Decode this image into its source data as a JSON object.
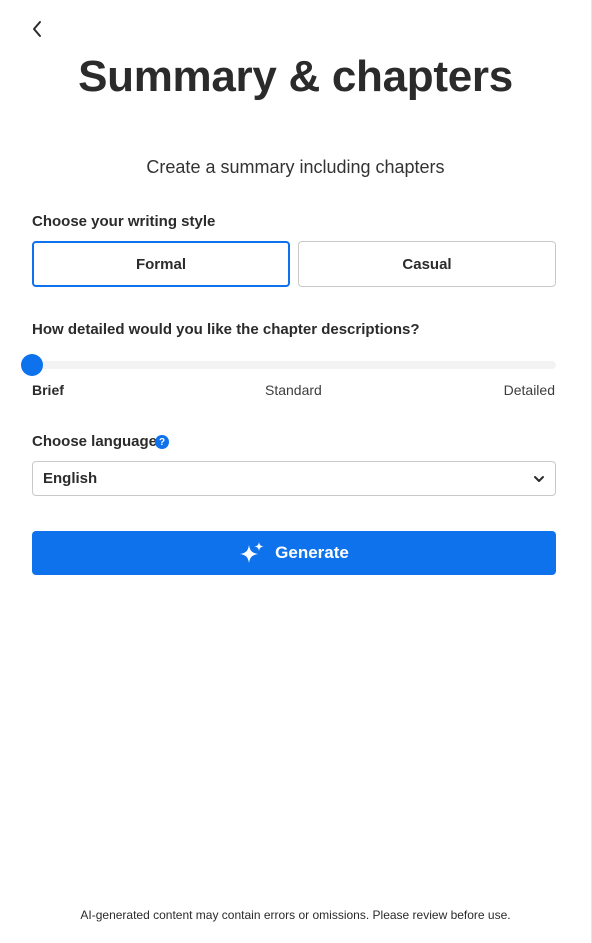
{
  "header": {
    "back_icon": "chevron-left-icon",
    "title": "Summary & chapters",
    "subtitle": "Create a summary including chapters"
  },
  "writing_style": {
    "label": "Choose your writing style",
    "options": [
      {
        "label": "Formal",
        "selected": true
      },
      {
        "label": "Casual",
        "selected": false
      }
    ]
  },
  "detail_level": {
    "label": "How detailed would you like the chapter descriptions?",
    "ticks": [
      "Brief",
      "Standard",
      "Detailed"
    ],
    "selected": "Brief",
    "value_fraction": 0
  },
  "language": {
    "label": "Choose language",
    "help_icon": "question-circle-icon",
    "help_glyph": "?",
    "selected": "English",
    "dropdown_icon": "chevron-down-icon"
  },
  "actions": {
    "generate_label": "Generate",
    "generate_icon": "sparkle-icon"
  },
  "footer": {
    "disclaimer": "AI-generated content may contain errors or omissions. Please review before use."
  },
  "colors": {
    "accent": "#0e72ed",
    "text": "#2b2b2b",
    "border": "#c9c9c9",
    "track": "#f3f3f3"
  }
}
